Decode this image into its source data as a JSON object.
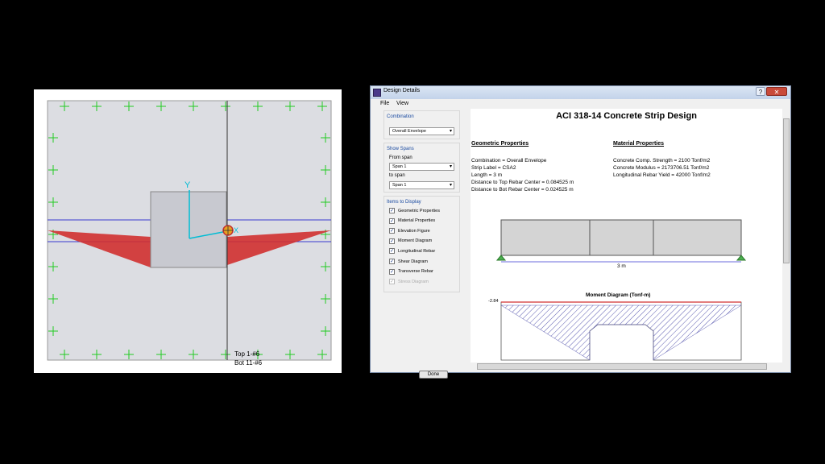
{
  "viewport": {
    "top_label": "Top 1-#6",
    "bot_label": "Bot 11-#6",
    "axis_y": "Y",
    "axis_x": "X"
  },
  "dialog": {
    "title": "Design Details",
    "menu": [
      "File",
      "View"
    ],
    "title_buttons": {
      "help": "?",
      "close": "✕"
    },
    "combination": {
      "title": "Combination",
      "value": "Overall Envelope"
    },
    "show_spans": {
      "title": "Show Spans",
      "from_label": "From span",
      "from_value": "Span 1",
      "to_label": "to span",
      "to_value": "Span 1"
    },
    "items_to_display": {
      "title": "Items to Display",
      "items": [
        {
          "label": "Geometric Properties",
          "checked": true,
          "enabled": true
        },
        {
          "label": "Material Properties",
          "checked": true,
          "enabled": true
        },
        {
          "label": "Elevation Figure",
          "checked": true,
          "enabled": true
        },
        {
          "label": "Moment Diagram",
          "checked": true,
          "enabled": true
        },
        {
          "label": "Longitudinal Rebar",
          "checked": true,
          "enabled": true
        },
        {
          "label": "Shear Diagram",
          "checked": true,
          "enabled": true
        },
        {
          "label": "Transverse Rebar",
          "checked": true,
          "enabled": true
        },
        {
          "label": "Stress Diagram",
          "checked": true,
          "enabled": false
        }
      ]
    },
    "done_label": "Done",
    "report": {
      "title": "ACI 318-14 Concrete Strip Design",
      "geometric_heading": "Geometric Properties",
      "material_heading": "Material Properties",
      "geometric_lines": [
        "Combination = Overall Envelope",
        "Strip Label = CSA2",
        "Length = 3 m",
        "Distance to Top Rebar Center = 0.084525 m",
        "Distance to Bot Rebar Center = 0.024525 m"
      ],
      "material_lines": [
        "Concrete Comp. Strength = 2100 Tonf/m2",
        "Concrete Modulus = 2173706.51 Tonf/m2",
        "Longitudinal Rebar Yield = 42000 Tonf/m2"
      ],
      "span_length_label": "3 m",
      "moment_title": "Moment Diagram (Tonf-m)",
      "moment_value_label": "-2.84"
    }
  },
  "colors": {
    "moment_fill": "#d03030",
    "hatch": "#5a5ab0",
    "axis_cyan": "#00bcd4",
    "grid_green": "#22cc22",
    "support_green": "#4caf50"
  }
}
